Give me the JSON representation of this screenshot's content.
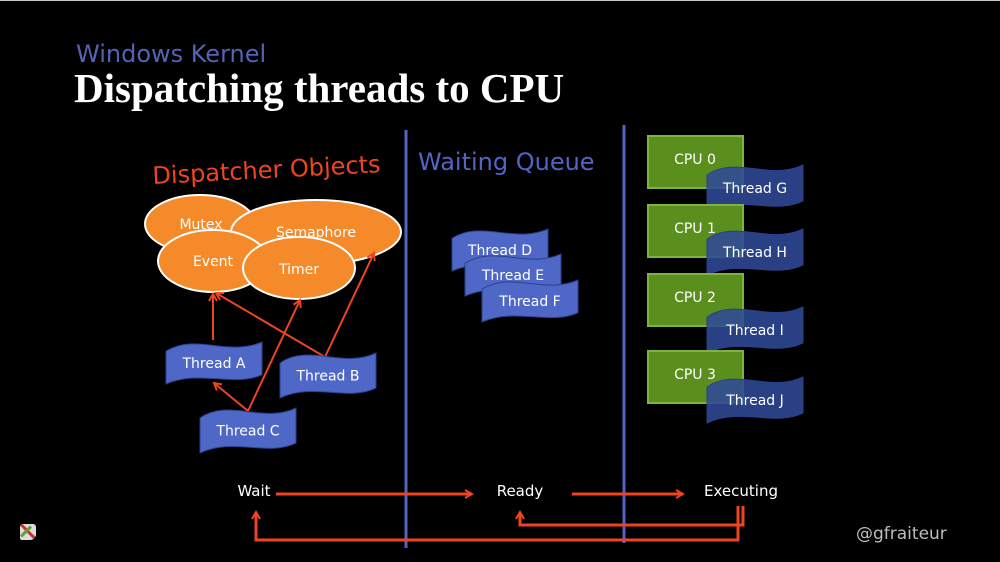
{
  "slide": {
    "subtitle": "Windows Kernel",
    "title": "Dispatching threads to CPU",
    "handle": "@gfraiteur"
  },
  "sections": {
    "dispatcher": "Dispatcher Objects",
    "waiting": "Waiting Queue"
  },
  "colors": {
    "orange": "#f58a2a",
    "red_arrow": "#ee4422",
    "thread_blue": "#4f68c8",
    "thread_dark": "#2f4a96",
    "cpu_green": "#5a8f1e",
    "divider": "#5563c5"
  },
  "dispatcher_objects": [
    {
      "id": "mutex",
      "label": "Mutex"
    },
    {
      "id": "semaphore",
      "label": "Semaphore"
    },
    {
      "id": "event",
      "label": "Event"
    },
    {
      "id": "timer",
      "label": "Timer"
    }
  ],
  "waiting_threads": [
    {
      "id": "a",
      "label": "Thread A"
    },
    {
      "id": "b",
      "label": "Thread B"
    },
    {
      "id": "c",
      "label": "Thread C"
    }
  ],
  "queue_threads": [
    {
      "id": "d",
      "label": "Thread D"
    },
    {
      "id": "e",
      "label": "Thread E"
    },
    {
      "id": "f",
      "label": "Thread F"
    }
  ],
  "cpus": [
    {
      "label": "CPU 0",
      "thread": "Thread G"
    },
    {
      "label": "CPU 1",
      "thread": "Thread H"
    },
    {
      "label": "CPU 2",
      "thread": "Thread I"
    },
    {
      "label": "CPU 3",
      "thread": "Thread J"
    }
  ],
  "states": {
    "wait": "Wait",
    "ready": "Ready",
    "executing": "Executing"
  }
}
